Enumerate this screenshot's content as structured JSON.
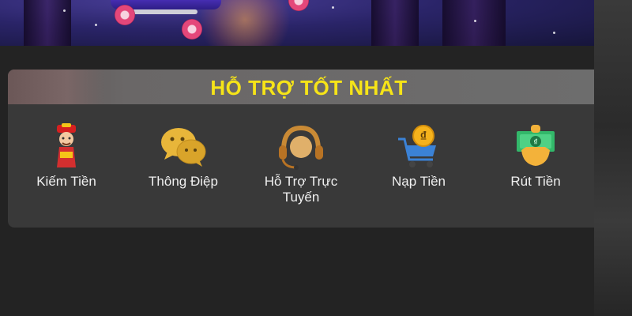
{
  "panel": {
    "title": "HỖ TRỢ TỐT NHẤT",
    "title_color": "#f6e418",
    "items": [
      {
        "label": "Kiếm Tiền",
        "icon": "god-of-wealth-icon"
      },
      {
        "label": "Thông Điệp",
        "icon": "chat-bubbles-icon"
      },
      {
        "label": "Hỗ Trợ Trực Tuyến",
        "icon": "headset-icon"
      },
      {
        "label": "Nạp Tiền",
        "icon": "shopping-cart-dong-icon"
      },
      {
        "label": "Rút Tiền",
        "icon": "hand-money-icon"
      }
    ]
  }
}
